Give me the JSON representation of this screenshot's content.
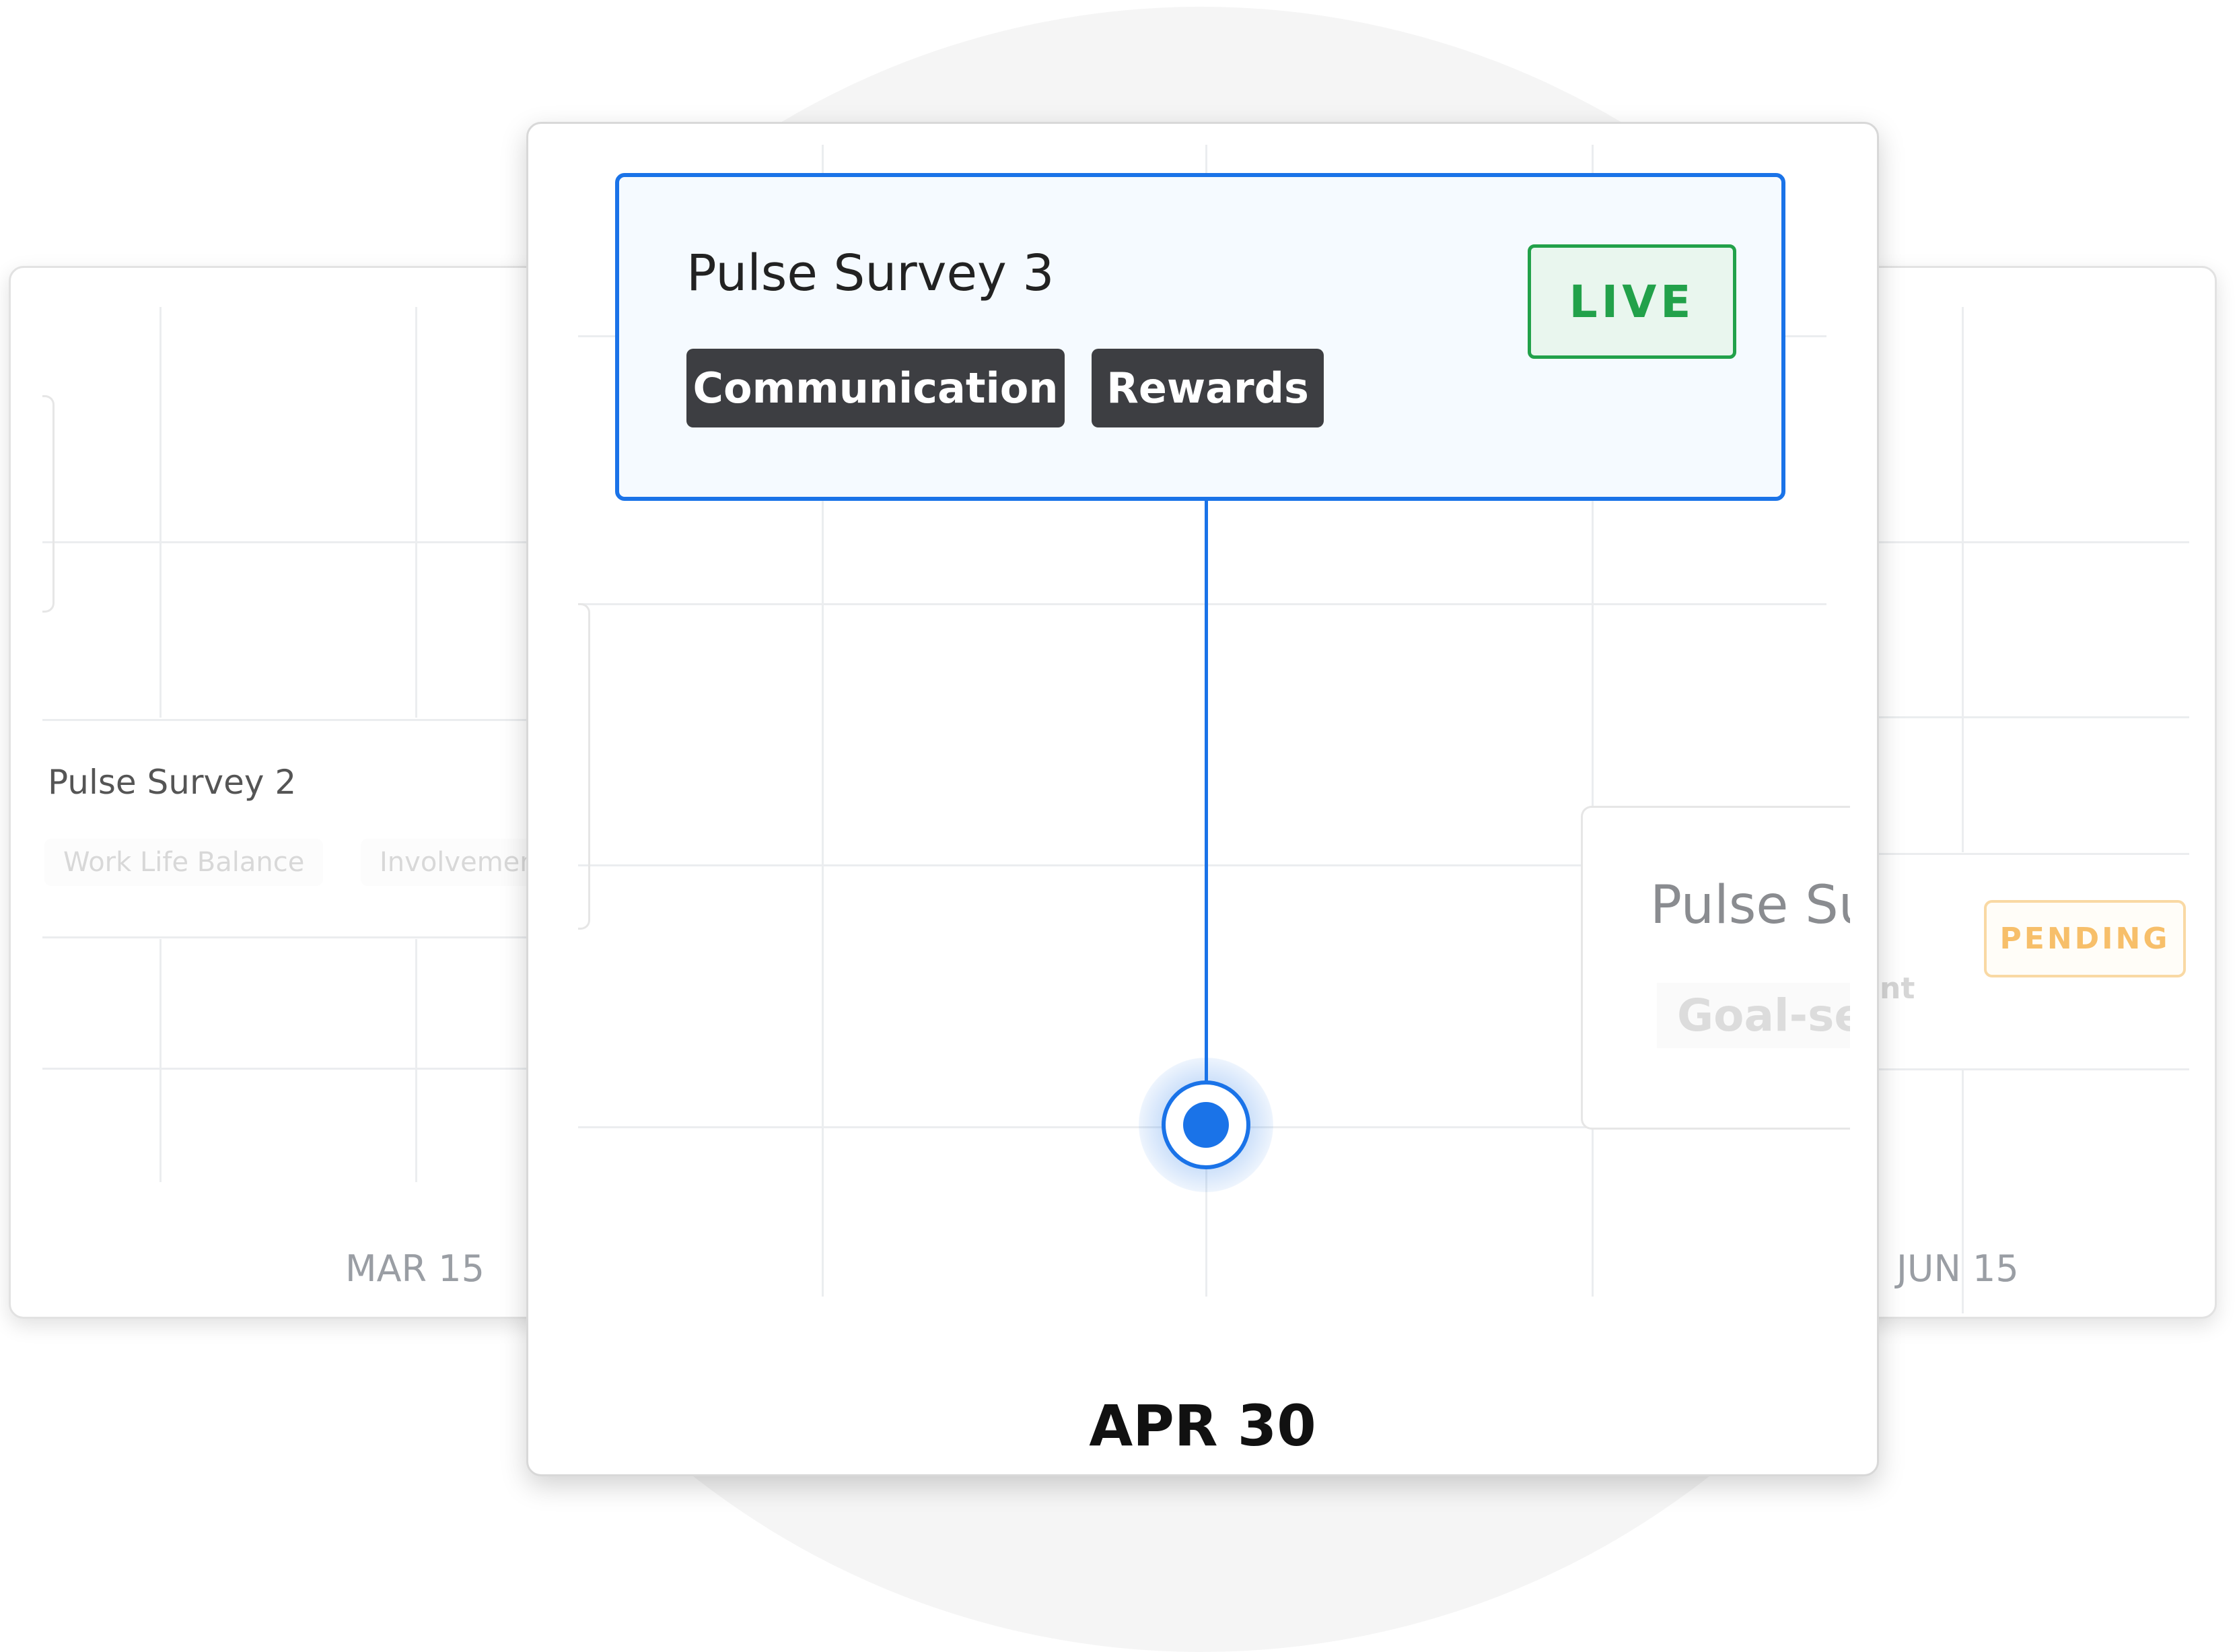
{
  "left_card": {
    "survey_title": "Pulse Survey 2",
    "tags": [
      "Work Life Balance",
      "Involvemen"
    ],
    "date": "MAR 15"
  },
  "center_card": {
    "survey_title": "Pulse Survey 3",
    "tags": [
      "Communication",
      "Rewards"
    ],
    "status": "LIVE",
    "date": "APR 30",
    "next_survey_title": "Pulse Su",
    "next_survey_tag": "Goal-se"
  },
  "right_card": {
    "status": "PENDING",
    "tag_fragment": "nt",
    "date": "JUN 15"
  },
  "colors": {
    "accent_blue": "#1a73e8",
    "live_green": "#22a14a",
    "pending_orange": "#f7bf6a",
    "tag_dark": "#3d3e42"
  }
}
